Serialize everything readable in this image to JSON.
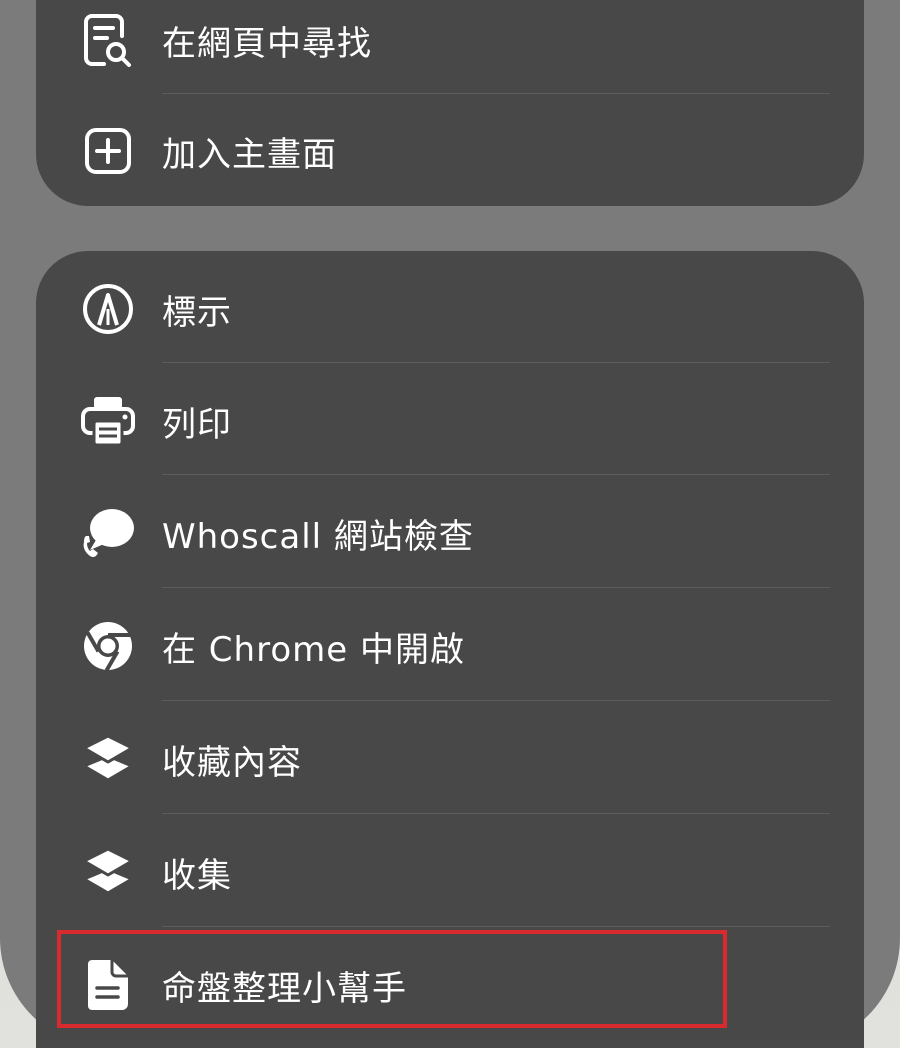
{
  "colors": {
    "card_background": "#484848",
    "text": "#ffffff",
    "highlight_border": "#d92b2f"
  },
  "top_group": {
    "items": [
      {
        "label": "在網頁中尋找",
        "icon": "find-in-page-icon"
      },
      {
        "label": "加入主畫面",
        "icon": "add-square-icon"
      }
    ]
  },
  "main_group": {
    "items": [
      {
        "label": "標示",
        "icon": "markup-pen-icon"
      },
      {
        "label": "列印",
        "icon": "printer-icon"
      },
      {
        "label": "Whoscall 網站檢查",
        "icon": "whoscall-bubble-icon"
      },
      {
        "label": "在 Chrome 中開啟",
        "icon": "chrome-icon"
      },
      {
        "label": "收藏內容",
        "icon": "layers-icon"
      },
      {
        "label": "收集",
        "icon": "layers-icon"
      },
      {
        "label": "命盤整理小幫手",
        "icon": "document-icon"
      }
    ]
  }
}
